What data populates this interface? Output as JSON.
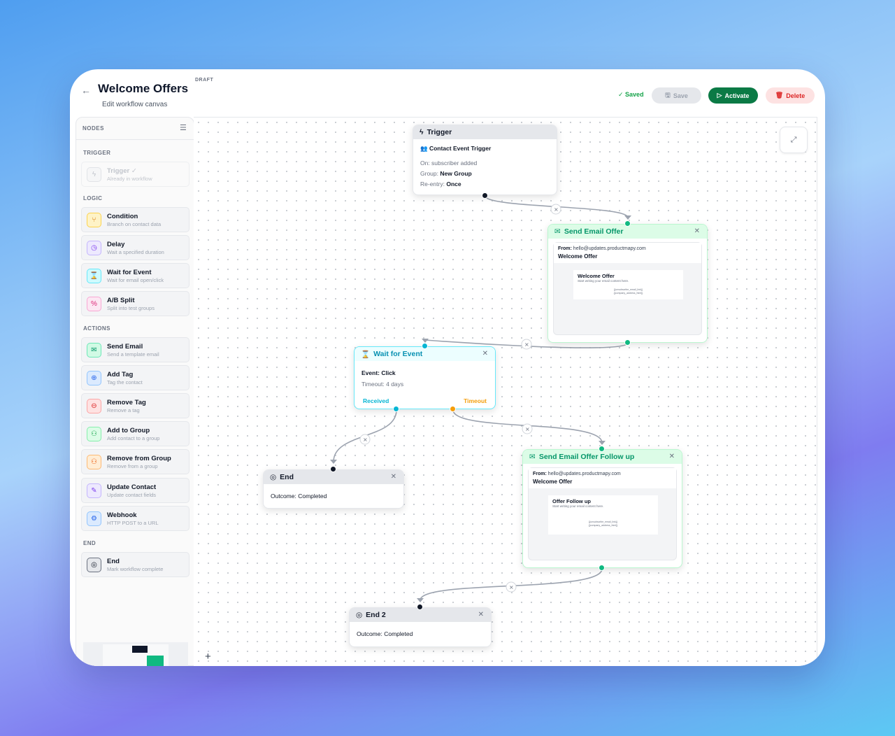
{
  "header": {
    "back_icon": "arrow-left-icon",
    "title": "Welcome Offers",
    "status_badge": "DRAFT",
    "subtitle": "Edit workflow canvas",
    "saved_label": "Saved",
    "save_label": "Save",
    "activate_label": "Activate",
    "delete_label": "Delete"
  },
  "sidebar": {
    "title": "NODES",
    "sections": {
      "trigger": "TRIGGER",
      "logic": "LOGIC",
      "actions": "ACTIONS",
      "end": "END"
    },
    "trigger_item": {
      "label": "Trigger ✓",
      "desc": "Already in workflow"
    },
    "logic_items": [
      {
        "label": "Condition",
        "desc": "Branch on contact data"
      },
      {
        "label": "Delay",
        "desc": "Wait a specified duration"
      },
      {
        "label": "Wait for Event",
        "desc": "Wait for email open/click"
      },
      {
        "label": "A/B Split",
        "desc": "Split into test groups"
      }
    ],
    "action_items": [
      {
        "label": "Send Email",
        "desc": "Send a template email"
      },
      {
        "label": "Add Tag",
        "desc": "Tag the contact"
      },
      {
        "label": "Remove Tag",
        "desc": "Remove a tag"
      },
      {
        "label": "Add to Group",
        "desc": "Add contact to a group"
      },
      {
        "label": "Remove from Group",
        "desc": "Remove from a group"
      },
      {
        "label": "Update Contact",
        "desc": "Update contact fields"
      },
      {
        "label": "Webhook",
        "desc": "HTTP POST to a URL"
      }
    ],
    "end_item": {
      "label": "End",
      "desc": "Mark workflow complete"
    }
  },
  "canvas": {
    "trigger_node": {
      "title": "Trigger",
      "type": "Contact Event Trigger",
      "on": "On: subscriber added",
      "group_label": "Group:",
      "group_value": "New Group",
      "reentry_label": "Re-entry:",
      "reentry_value": "Once"
    },
    "email1_node": {
      "title": "Send Email Offer",
      "from_label": "From:",
      "from_value": "hello@updates.productmapy.com",
      "subject": "Welcome Offer",
      "preview_title": "Welcome Offer",
      "preview_sub": "Start writing your email content here.",
      "preview_meta1": "{{unsubscribe_email_link}}",
      "preview_meta2": "{{company_address_html}}"
    },
    "wait_node": {
      "title": "Wait for Event",
      "event": "Event: Click",
      "timeout": "Timeout: 4 days",
      "received": "Received",
      "timeout_label": "Timeout"
    },
    "end_node": {
      "title": "End",
      "outcome": "Outcome: Completed"
    },
    "email2_node": {
      "title": "Send Email Offer Follow up",
      "from_label": "From:",
      "from_value": "hello@updates.productmapy.com",
      "subject": "Welcome Offer",
      "preview_title": "Offer Follow up",
      "preview_sub": "Start writing your email content here.",
      "preview_meta1": "{{unsubscribe_email_link}}",
      "preview_meta2": "{{company_address_html}}"
    },
    "end2_node": {
      "title": "End 2",
      "outcome": "Outcome: Completed"
    }
  },
  "colors": {
    "accent_green": "#0b7a45",
    "email_green": "#10b981",
    "wait_cyan": "#06b6d4",
    "timeout_orange": "#f59e0b",
    "delete_red": "#dc2626"
  }
}
